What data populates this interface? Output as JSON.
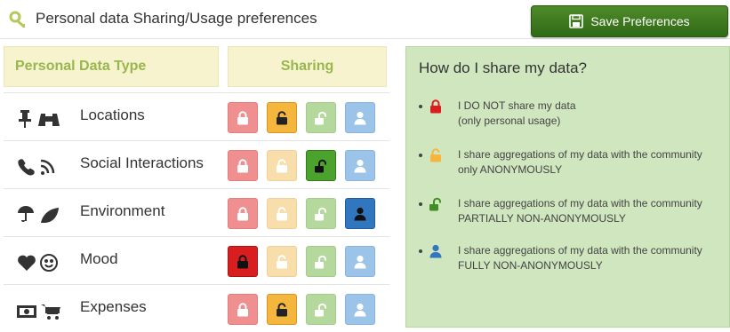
{
  "header": {
    "title": "Personal data Sharing/Usage preferences",
    "save_label": "Save Preferences"
  },
  "table": {
    "col_type": "Personal Data Type",
    "col_sharing": "Sharing",
    "rows": [
      {
        "label": "Locations",
        "selected": "anonymous"
      },
      {
        "label": "Social Interactions",
        "selected": "partial"
      },
      {
        "label": "Environment",
        "selected": "full"
      },
      {
        "label": "Mood",
        "selected": "none"
      },
      {
        "label": "Expenses",
        "selected": "anonymous"
      }
    ]
  },
  "legend": {
    "title": "How do I share my data?",
    "items": [
      {
        "line1": "I DO NOT share my data",
        "line2": "(only personal usage)"
      },
      {
        "line1": "I share aggregations of my data with the community",
        "line2": "only ANONYMOUSLY"
      },
      {
        "line1": "I share aggregations of my data with the community",
        "line2": "PARTIALLY NON-ANONYMOUSLY"
      },
      {
        "line1": "I share aggregations of my data with the community",
        "line2": "FULLY NON-ANONYMOUSLY"
      }
    ]
  },
  "colors": {
    "accent_green": "#3f7d21",
    "header_label": "#98b74e",
    "legend_bg": "#cfe6bf",
    "lock_red": "#d81e1e",
    "lock_orange": "#f5b63d",
    "lock_green": "#4ba22d",
    "user_blue": "#3077bf"
  },
  "icons": {
    "title": "key-icon",
    "save": "floppy-disk-icon",
    "rows": [
      [
        "pushpin-icon",
        "binoculars-icon"
      ],
      [
        "phone-icon",
        "rss-icon"
      ],
      [
        "umbrella-icon",
        "leaf-icon"
      ],
      [
        "heart-icon",
        "smiley-icon"
      ],
      [
        "banknote-icon",
        "cart-icon"
      ]
    ]
  }
}
